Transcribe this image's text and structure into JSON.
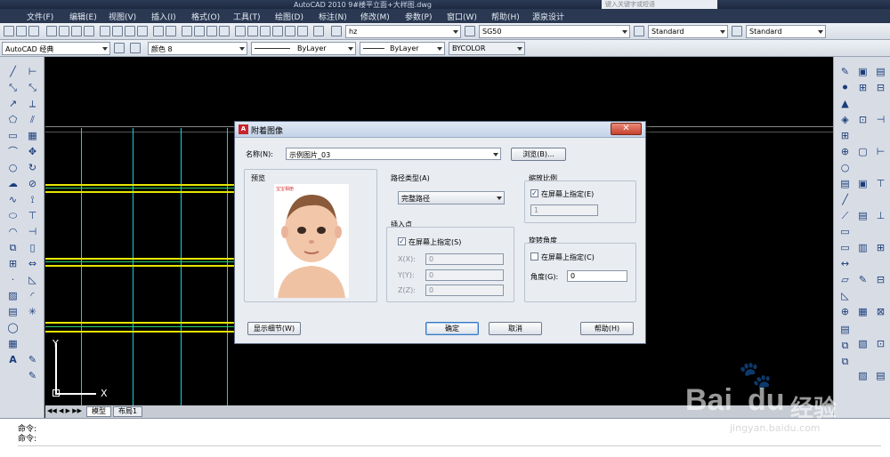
{
  "window": {
    "title": "AutoCAD 2010      9#楼平立面+大样图.dwg",
    "search_placeholder": "键入关键字或短语"
  },
  "menu": [
    "文件(F)",
    "编辑(E)",
    "视图(V)",
    "插入(I)",
    "格式(O)",
    "工具(T)",
    "绘图(D)",
    "标注(N)",
    "修改(M)",
    "参数(P)",
    "窗口(W)",
    "帮助(H)",
    "源泉设计"
  ],
  "toolbar1": {
    "text_style": "hz",
    "dim_style": "SG50",
    "table_style": "Standard",
    "multileader_style": "Standard"
  },
  "toolbar2": {
    "workspace": "AutoCAD 经典",
    "layer": "颜色 8",
    "linetype": "ByLayer",
    "lineweight": "ByLayer",
    "plotstyle": "BYCOLOR"
  },
  "tabs": [
    "模型",
    "布局1"
  ],
  "ucs": {
    "x": "X",
    "y": "Y"
  },
  "command": {
    "line1": "命令:",
    "line2": "命令:"
  },
  "dialog": {
    "title": "附着图像",
    "name_label": "名称(N):",
    "name_value": "示例图片_03",
    "browse": "浏览(B)...",
    "preview_label": "预览",
    "preview_logo_text": "宝宝相册",
    "path_type_label": "路径类型(A)",
    "path_type_value": "完整路径",
    "insert_point_label": "插入点",
    "insert_specify": "在屏幕上指定(S)",
    "x_label": "X(X):",
    "x_value": "0",
    "y_label": "Y(Y):",
    "y_value": "0",
    "z_label": "Z(Z):",
    "z_value": "0",
    "scale_label": "缩放比例",
    "scale_specify": "在屏幕上指定(E)",
    "scale_value": "1",
    "rotation_label": "旋转角度",
    "rotation_specify": "在屏幕上指定(C)",
    "angle_label": "角度(G):",
    "angle_value": "0",
    "details_button": "显示细节(W)",
    "ok_button": "确定",
    "cancel_button": "取消",
    "help_button": "帮助(H)",
    "insert_checked": true,
    "scale_checked": true,
    "rotation_checked": false
  },
  "watermark": {
    "brand": "Bai",
    "brand2": "du",
    "cn": "经验",
    "url": "jingyan.baidu.com"
  },
  "colors": {
    "canvas": "#000000",
    "grid_cyan": "#0bd3e6",
    "grid_yellow": "#e6e600",
    "grid_green": "#29d36a",
    "title_bar": "#2a3852"
  }
}
